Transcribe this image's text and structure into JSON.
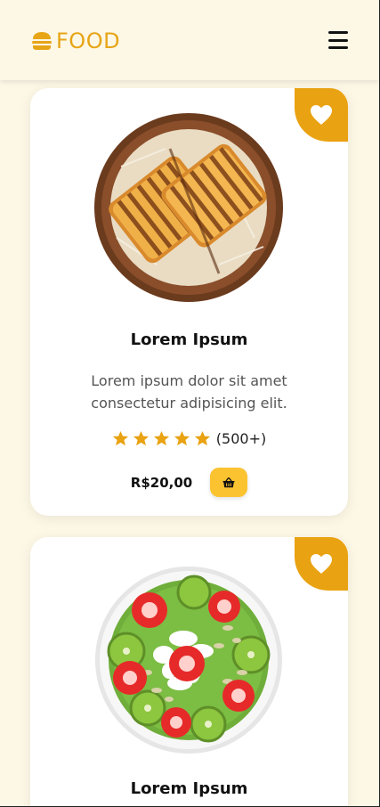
{
  "header": {
    "brand": "FOOD",
    "logo_icon": "burger-icon",
    "menu_icon": "hamburger-menu-icon"
  },
  "colors": {
    "accent": "#e9a211",
    "cart_button": "#fcc331",
    "background": "#fdf7e6"
  },
  "products": [
    {
      "title": "Lorem Ipsum",
      "description": "Lorem ipsum dolor sit amet consectetur adipisicing elit.",
      "image": "toasted-sandwich-bowl",
      "rating": 5,
      "rating_count": "(500+)",
      "price": "R$20,00",
      "favorite_icon": "heart-icon",
      "cart_icon": "basket-icon"
    },
    {
      "title": "Lorem Ipsum",
      "image": "strawberry-kiwi-smoothie-bowl",
      "favorite_icon": "heart-icon"
    }
  ]
}
